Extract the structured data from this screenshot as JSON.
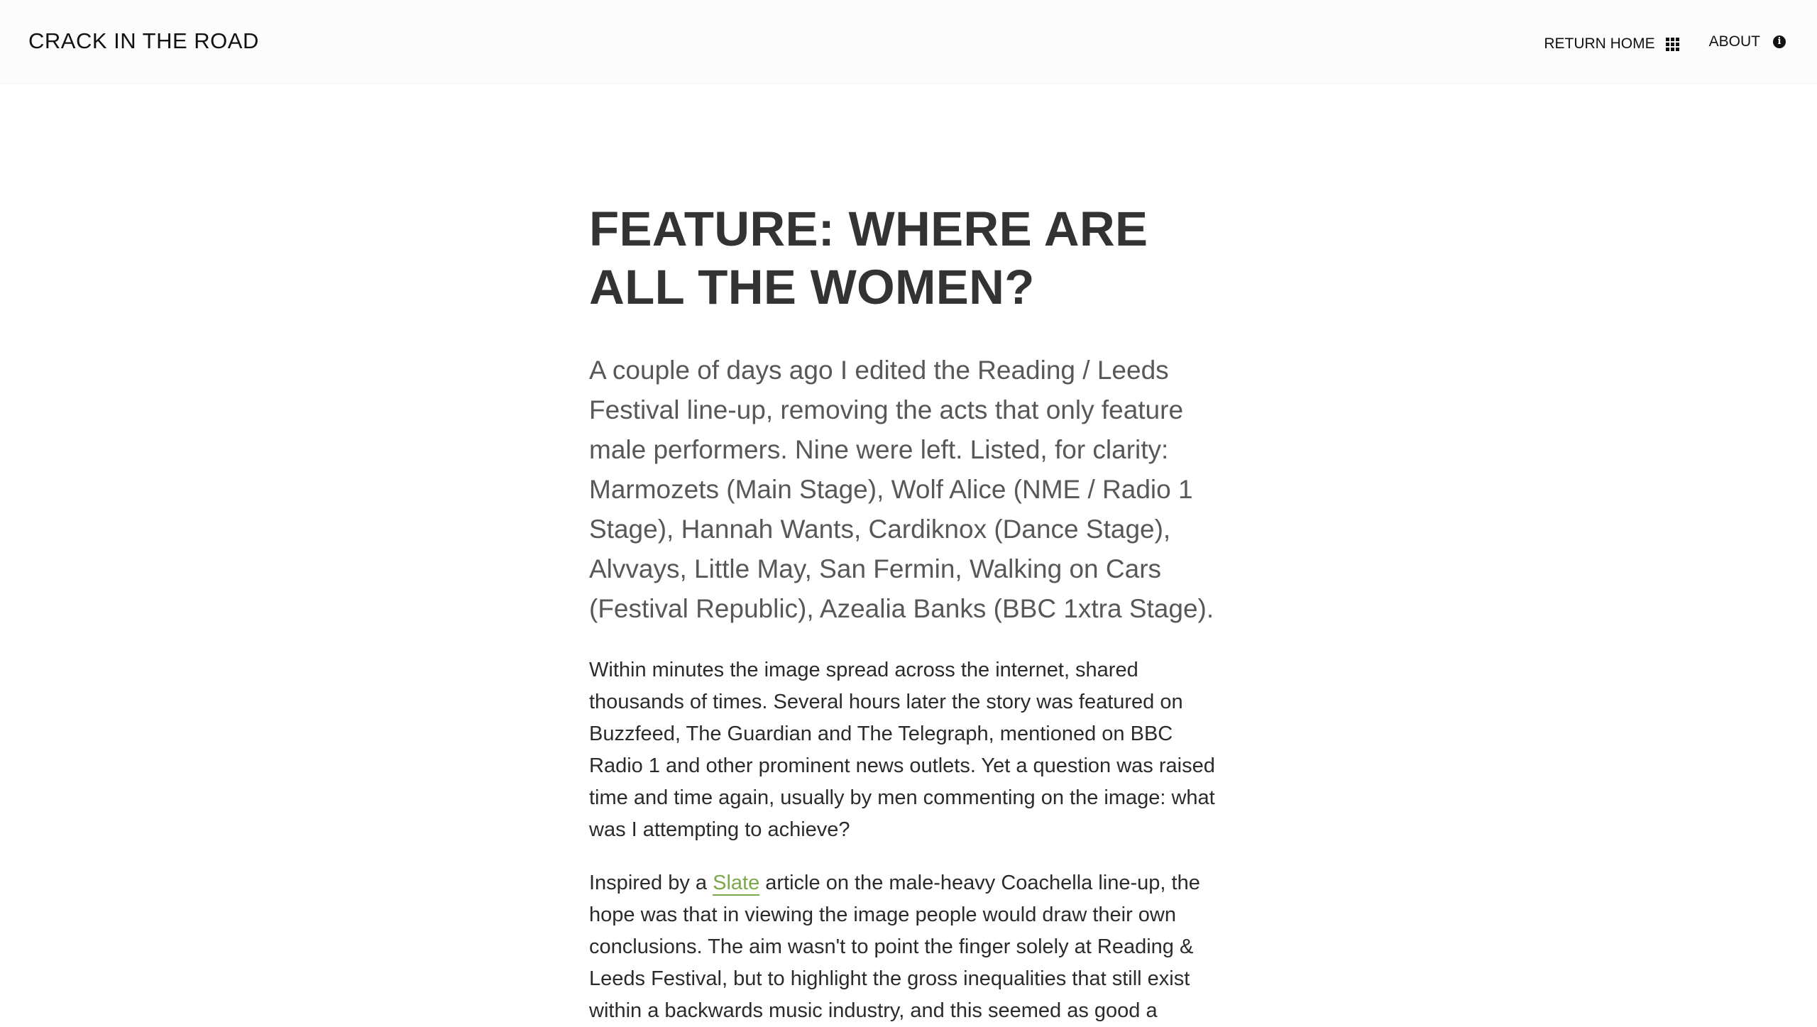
{
  "header": {
    "brand": "CRACK IN THE ROAD",
    "nav": {
      "home_label": "RETURN HOME",
      "about_label": "ABOUT",
      "home_icon": "grid-icon",
      "about_icon": "info-icon"
    }
  },
  "article": {
    "title": "FEATURE: WHERE ARE ALL THE WOMEN?",
    "lede": "A couple of days ago I edited the Reading / Leeds Festival line-up, removing the acts that only feature male performers. Nine were left. Listed, for clarity: Marmozets (Main Stage), Wolf Alice (NME / Radio 1 Stage), Hannah Wants, Cardiknox (Dance Stage), Alvvays, Little May, San Fermin, Walking on Cars (Festival Republic), Azealia Banks (BBC 1xtra Stage).",
    "paragraph1": "Within minutes the image spread across the internet, shared thousands of times. Several hours later the story was featured on Buzzfeed, The Guardian and The Telegraph, mentioned on BBC Radio 1 and other prominent news outlets. Yet a question was raised time and time again, usually by men commenting on the image: what was I attempting to achieve?",
    "paragraph2": {
      "before_link": "Inspired by a ",
      "link_text": "Slate",
      "after_link": " article on the male-heavy Coachella line-up, the hope was that in viewing the image people would draw their own conclusions. The aim wasn't to point the finger solely at Reading & Leeds Festival, but to highlight the gross inequalities that still exist within a backwards music industry, and this seemed as good a"
    }
  },
  "colors": {
    "link": "#7ba84a",
    "title": "#333333",
    "lede": "#585858",
    "body": "#2b2b2b"
  }
}
